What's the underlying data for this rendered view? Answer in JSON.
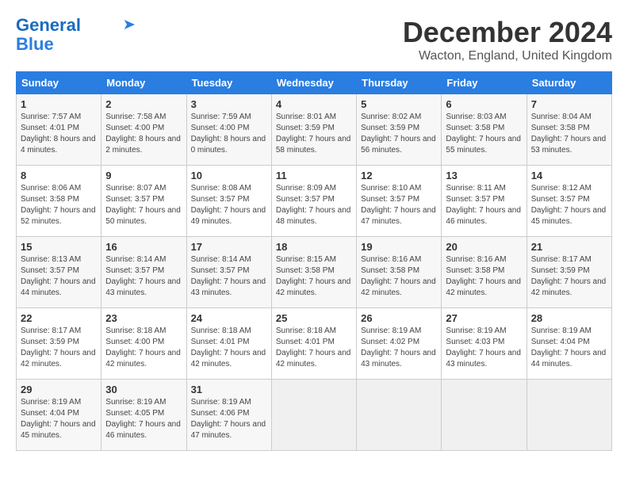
{
  "logo": {
    "line1": "General",
    "line2": "Blue"
  },
  "title": "December 2024",
  "subtitle": "Wacton, England, United Kingdom",
  "columns": [
    "Sunday",
    "Monday",
    "Tuesday",
    "Wednesday",
    "Thursday",
    "Friday",
    "Saturday"
  ],
  "weeks": [
    [
      {
        "day": "1",
        "sunrise": "7:57 AM",
        "sunset": "4:01 PM",
        "daylight": "8 hours and 4 minutes."
      },
      {
        "day": "2",
        "sunrise": "7:58 AM",
        "sunset": "4:00 PM",
        "daylight": "8 hours and 2 minutes."
      },
      {
        "day": "3",
        "sunrise": "7:59 AM",
        "sunset": "4:00 PM",
        "daylight": "8 hours and 0 minutes."
      },
      {
        "day": "4",
        "sunrise": "8:01 AM",
        "sunset": "3:59 PM",
        "daylight": "7 hours and 58 minutes."
      },
      {
        "day": "5",
        "sunrise": "8:02 AM",
        "sunset": "3:59 PM",
        "daylight": "7 hours and 56 minutes."
      },
      {
        "day": "6",
        "sunrise": "8:03 AM",
        "sunset": "3:58 PM",
        "daylight": "7 hours and 55 minutes."
      },
      {
        "day": "7",
        "sunrise": "8:04 AM",
        "sunset": "3:58 PM",
        "daylight": "7 hours and 53 minutes."
      }
    ],
    [
      {
        "day": "8",
        "sunrise": "8:06 AM",
        "sunset": "3:58 PM",
        "daylight": "7 hours and 52 minutes."
      },
      {
        "day": "9",
        "sunrise": "8:07 AM",
        "sunset": "3:57 PM",
        "daylight": "7 hours and 50 minutes."
      },
      {
        "day": "10",
        "sunrise": "8:08 AM",
        "sunset": "3:57 PM",
        "daylight": "7 hours and 49 minutes."
      },
      {
        "day": "11",
        "sunrise": "8:09 AM",
        "sunset": "3:57 PM",
        "daylight": "7 hours and 48 minutes."
      },
      {
        "day": "12",
        "sunrise": "8:10 AM",
        "sunset": "3:57 PM",
        "daylight": "7 hours and 47 minutes."
      },
      {
        "day": "13",
        "sunrise": "8:11 AM",
        "sunset": "3:57 PM",
        "daylight": "7 hours and 46 minutes."
      },
      {
        "day": "14",
        "sunrise": "8:12 AM",
        "sunset": "3:57 PM",
        "daylight": "7 hours and 45 minutes."
      }
    ],
    [
      {
        "day": "15",
        "sunrise": "8:13 AM",
        "sunset": "3:57 PM",
        "daylight": "7 hours and 44 minutes."
      },
      {
        "day": "16",
        "sunrise": "8:14 AM",
        "sunset": "3:57 PM",
        "daylight": "7 hours and 43 minutes."
      },
      {
        "day": "17",
        "sunrise": "8:14 AM",
        "sunset": "3:57 PM",
        "daylight": "7 hours and 43 minutes."
      },
      {
        "day": "18",
        "sunrise": "8:15 AM",
        "sunset": "3:58 PM",
        "daylight": "7 hours and 42 minutes."
      },
      {
        "day": "19",
        "sunrise": "8:16 AM",
        "sunset": "3:58 PM",
        "daylight": "7 hours and 42 minutes."
      },
      {
        "day": "20",
        "sunrise": "8:16 AM",
        "sunset": "3:58 PM",
        "daylight": "7 hours and 42 minutes."
      },
      {
        "day": "21",
        "sunrise": "8:17 AM",
        "sunset": "3:59 PM",
        "daylight": "7 hours and 42 minutes."
      }
    ],
    [
      {
        "day": "22",
        "sunrise": "8:17 AM",
        "sunset": "3:59 PM",
        "daylight": "7 hours and 42 minutes."
      },
      {
        "day": "23",
        "sunrise": "8:18 AM",
        "sunset": "4:00 PM",
        "daylight": "7 hours and 42 minutes."
      },
      {
        "day": "24",
        "sunrise": "8:18 AM",
        "sunset": "4:01 PM",
        "daylight": "7 hours and 42 minutes."
      },
      {
        "day": "25",
        "sunrise": "8:18 AM",
        "sunset": "4:01 PM",
        "daylight": "7 hours and 42 minutes."
      },
      {
        "day": "26",
        "sunrise": "8:19 AM",
        "sunset": "4:02 PM",
        "daylight": "7 hours and 43 minutes."
      },
      {
        "day": "27",
        "sunrise": "8:19 AM",
        "sunset": "4:03 PM",
        "daylight": "7 hours and 43 minutes."
      },
      {
        "day": "28",
        "sunrise": "8:19 AM",
        "sunset": "4:04 PM",
        "daylight": "7 hours and 44 minutes."
      }
    ],
    [
      {
        "day": "29",
        "sunrise": "8:19 AM",
        "sunset": "4:04 PM",
        "daylight": "7 hours and 45 minutes."
      },
      {
        "day": "30",
        "sunrise": "8:19 AM",
        "sunset": "4:05 PM",
        "daylight": "7 hours and 46 minutes."
      },
      {
        "day": "31",
        "sunrise": "8:19 AM",
        "sunset": "4:06 PM",
        "daylight": "7 hours and 47 minutes."
      },
      null,
      null,
      null,
      null
    ]
  ],
  "labels": {
    "sunrise": "Sunrise:",
    "sunset": "Sunset:",
    "daylight": "Daylight:"
  }
}
